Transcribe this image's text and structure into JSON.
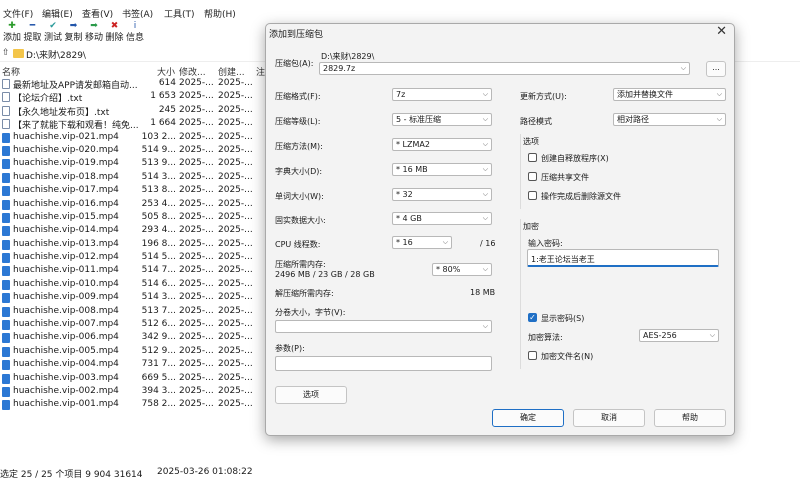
{
  "menu": [
    "文件(F)",
    "编辑(E)",
    "查看(V)",
    "书签(A)",
    "工具(T)",
    "帮助(H)"
  ],
  "toolbar": [
    {
      "label": "添加",
      "icon": "add-icon",
      "glyph": "✚",
      "color": "#2b9b2b"
    },
    {
      "label": "提取",
      "icon": "extract-icon",
      "glyph": "━",
      "color": "#2255aa"
    },
    {
      "label": "测试",
      "icon": "test-icon",
      "glyph": "✔",
      "color": "#2a9a9a"
    },
    {
      "label": "复制",
      "icon": "copy-icon",
      "glyph": "➡",
      "color": "#2255aa"
    },
    {
      "label": "移动",
      "icon": "move-icon",
      "glyph": "➡",
      "color": "#2a9a4a"
    },
    {
      "label": "删除",
      "icon": "delete-icon",
      "glyph": "✖",
      "color": "#cc2222"
    },
    {
      "label": "信息",
      "icon": "info-icon",
      "glyph": "i",
      "color": "#2255aa"
    }
  ],
  "address": "D:\\来财\\2829\\",
  "columns": {
    "name": "名称",
    "size": "大小",
    "modified": "修改...",
    "created": "创建...",
    "note": "注"
  },
  "files": [
    {
      "name": "最新地址及APP请发邮箱自动...",
      "size": "614",
      "mod": "2025-...",
      "cre": "2025-...",
      "type": "txt"
    },
    {
      "name": "【论坛介绍】.txt",
      "size": "1 653",
      "mod": "2025-...",
      "cre": "2025-...",
      "type": "txt"
    },
    {
      "name": "【永久地址发布页】.txt",
      "size": "245",
      "mod": "2025-...",
      "cre": "2025-...",
      "type": "txt"
    },
    {
      "name": "【来了就能下载和观看！纯免...",
      "size": "1 664",
      "mod": "2025-...",
      "cre": "2025-...",
      "type": "txt"
    },
    {
      "name": "huachishe.vip-021.mp4",
      "size": "103 2...",
      "mod": "2025-...",
      "cre": "2025-...",
      "type": "mp4"
    },
    {
      "name": "huachishe.vip-020.mp4",
      "size": "514 9...",
      "mod": "2025-...",
      "cre": "2025-...",
      "type": "mp4"
    },
    {
      "name": "huachishe.vip-019.mp4",
      "size": "513 9...",
      "mod": "2025-...",
      "cre": "2025-...",
      "type": "mp4"
    },
    {
      "name": "huachishe.vip-018.mp4",
      "size": "514 3...",
      "mod": "2025-...",
      "cre": "2025-...",
      "type": "mp4"
    },
    {
      "name": "huachishe.vip-017.mp4",
      "size": "513 8...",
      "mod": "2025-...",
      "cre": "2025-...",
      "type": "mp4"
    },
    {
      "name": "huachishe.vip-016.mp4",
      "size": "253 4...",
      "mod": "2025-...",
      "cre": "2025-...",
      "type": "mp4"
    },
    {
      "name": "huachishe.vip-015.mp4",
      "size": "505 8...",
      "mod": "2025-...",
      "cre": "2025-...",
      "type": "mp4"
    },
    {
      "name": "huachishe.vip-014.mp4",
      "size": "293 4...",
      "mod": "2025-...",
      "cre": "2025-...",
      "type": "mp4"
    },
    {
      "name": "huachishe.vip-013.mp4",
      "size": "196 8...",
      "mod": "2025-...",
      "cre": "2025-...",
      "type": "mp4"
    },
    {
      "name": "huachishe.vip-012.mp4",
      "size": "514 5...",
      "mod": "2025-...",
      "cre": "2025-...",
      "type": "mp4"
    },
    {
      "name": "huachishe.vip-011.mp4",
      "size": "514 7...",
      "mod": "2025-...",
      "cre": "2025-...",
      "type": "mp4"
    },
    {
      "name": "huachishe.vip-010.mp4",
      "size": "514 6...",
      "mod": "2025-...",
      "cre": "2025-...",
      "type": "mp4"
    },
    {
      "name": "huachishe.vip-009.mp4",
      "size": "514 3...",
      "mod": "2025-...",
      "cre": "2025-...",
      "type": "mp4"
    },
    {
      "name": "huachishe.vip-008.mp4",
      "size": "513 7...",
      "mod": "2025-...",
      "cre": "2025-...",
      "type": "mp4"
    },
    {
      "name": "huachishe.vip-007.mp4",
      "size": "512 6...",
      "mod": "2025-...",
      "cre": "2025-...",
      "type": "mp4"
    },
    {
      "name": "huachishe.vip-006.mp4",
      "size": "342 9...",
      "mod": "2025-...",
      "cre": "2025-...",
      "type": "mp4"
    },
    {
      "name": "huachishe.vip-005.mp4",
      "size": "512 9...",
      "mod": "2025-...",
      "cre": "2025-...",
      "type": "mp4"
    },
    {
      "name": "huachishe.vip-004.mp4",
      "size": "731 7...",
      "mod": "2025-...",
      "cre": "2025-...",
      "type": "mp4"
    },
    {
      "name": "huachishe.vip-003.mp4",
      "size": "669 5...",
      "mod": "2025-...",
      "cre": "2025-...",
      "type": "mp4"
    },
    {
      "name": "huachishe.vip-002.mp4",
      "size": "394 3...",
      "mod": "2025-...",
      "cre": "2025-...",
      "type": "mp4"
    },
    {
      "name": "huachishe.vip-001.mp4",
      "size": "758 2...",
      "mod": "2025-...",
      "cre": "2025-...",
      "type": "mp4"
    }
  ],
  "status": {
    "selection": "选定 25 / 25 个项目 9 904 31614",
    "datetime": "2025-03-26 01:08:22"
  },
  "dialog": {
    "title": "添加到压缩包",
    "archive_label": "压缩包(A):",
    "archive_dir": "D:\\来财\\2829\\",
    "archive_name": "2829.7z",
    "browse_label": "...",
    "format_label": "压缩格式(F):",
    "format_value": "7z",
    "level_label": "压缩等级(L):",
    "level_value": "5 - 标准压缩",
    "method_label": "压缩方法(M):",
    "method_value": "*  LZMA2",
    "dict_label": "字典大小(D):",
    "dict_value": "*  16 MB",
    "word_label": "单词大小(W):",
    "word_value": "*  32",
    "solid_label": "固实数据大小:",
    "solid_value": "*  4 GB",
    "cpu_label": "CPU 线程数:",
    "cpu_value": "*  16",
    "cpu_total": "/ 16",
    "mem_label": "压缩所需内存:",
    "mem_value": "2496 MB / 23 GB / 28 GB",
    "mem_pct": "*  80%",
    "decomp_label": "解压缩所需内存:",
    "decomp_value": "18 MB",
    "split_label": "分卷大小，字节(V):",
    "params_label": "参数(P):",
    "options_button": "选项",
    "update_label": "更新方式(U):",
    "update_value": "添加并替换文件",
    "pathmode_label": "路径模式",
    "pathmode_value": "相对路径",
    "options_group": "选项",
    "opt_sfx": "创建自释放程序(X)",
    "opt_shared": "压缩共享文件",
    "opt_delete": "操作完成后删除源文件",
    "encrypt_group": "加密",
    "pw_label": "输入密码:",
    "pw_value": "1:老王论坛当老王",
    "show_pw": "显示密码(S)",
    "enc_method_label": "加密算法:",
    "enc_method_value": "AES-256",
    "enc_names": "加密文件名(N)",
    "ok": "确定",
    "cancel": "取消",
    "help": "帮助"
  }
}
